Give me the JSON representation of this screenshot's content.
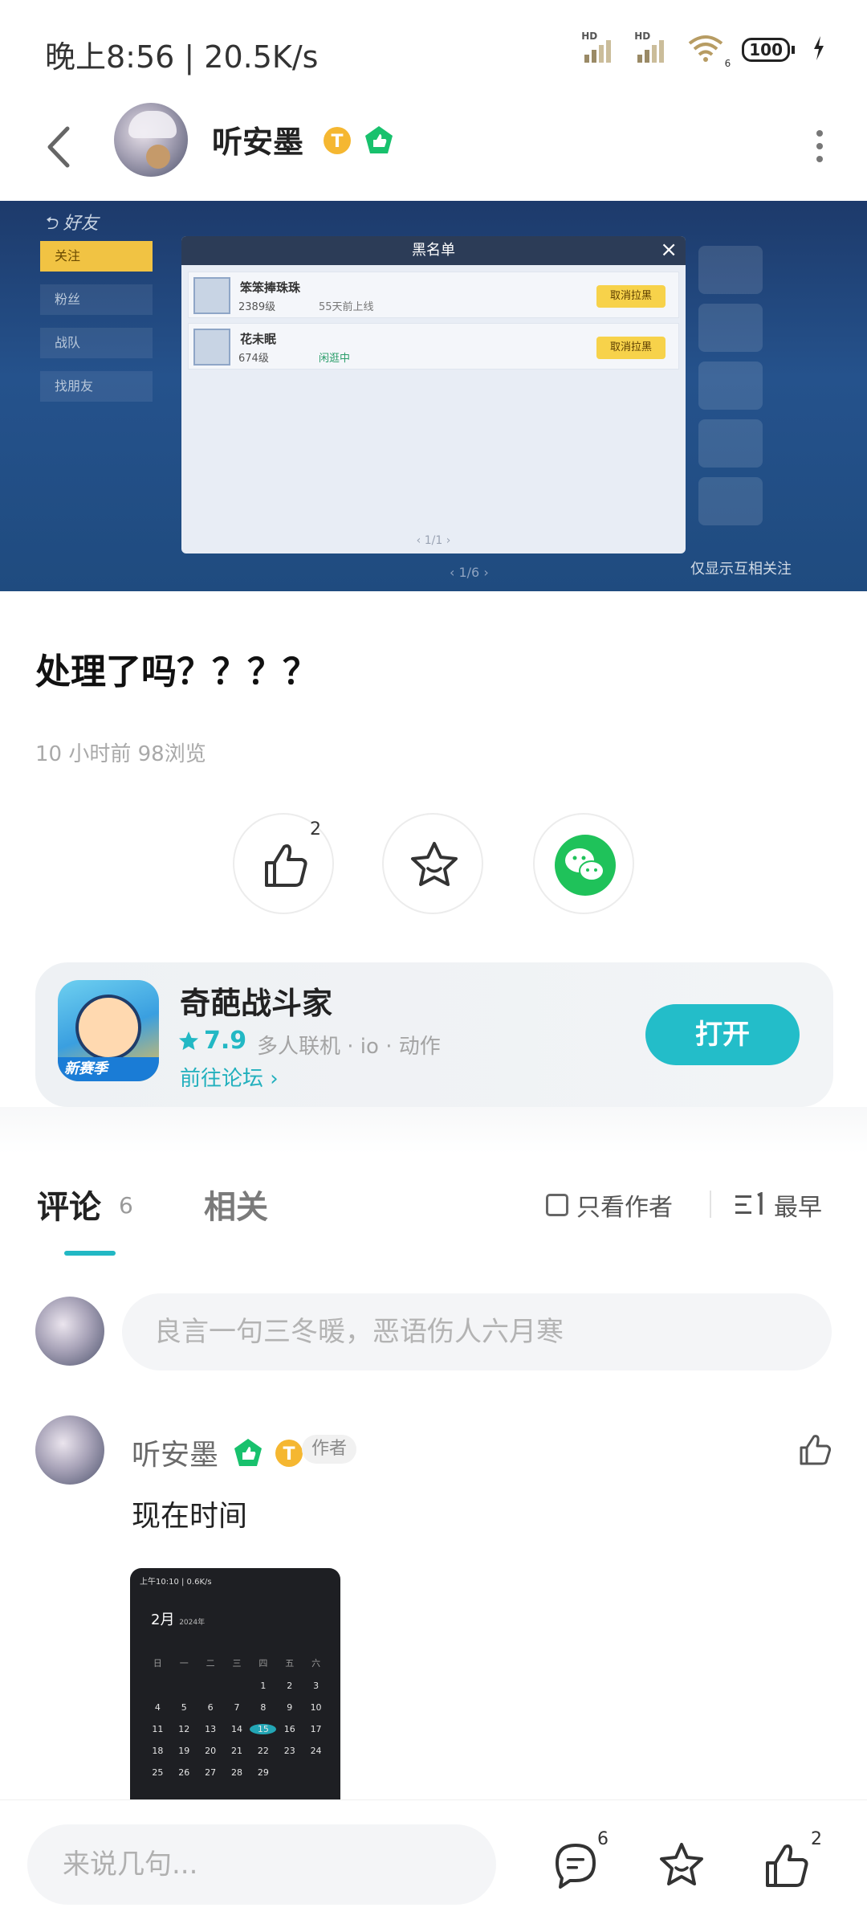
{
  "status_bar": {
    "time": "晚上8:56 | 20.5K/s",
    "battery": "100",
    "signal1": "HD",
    "signal2": "HD",
    "wifi_badge": "6"
  },
  "header": {
    "author_name": "听安墨"
  },
  "screenshot": {
    "back_label": "好友",
    "nav_items": [
      "关注",
      "粉丝",
      "战队",
      "找朋友"
    ],
    "modal_title": "黑名单",
    "rows": [
      {
        "name": "笨笨捧珠珠",
        "level": "2389级",
        "status": "55天前上线",
        "button": "取消拉黑"
      },
      {
        "name": "花未眠",
        "level": "674级",
        "status": "闲逛中",
        "button": "取消拉黑"
      }
    ],
    "pager": "1/1",
    "pager2": "1/6",
    "footnote": "仅显示互相关注"
  },
  "post": {
    "title": "处理了吗？？？？",
    "meta": "10 小时前  98浏览",
    "like_count": "2"
  },
  "game": {
    "name": "奇葩战斗家",
    "score": "7.9",
    "tags": "多人联机 · io · 动作",
    "forum_link": "前往论坛",
    "open_button": "打开",
    "icon_tag": "新赛季"
  },
  "tabs": {
    "comments_label": "评论",
    "comments_count": "6",
    "related_label": "相关",
    "only_author": "只看作者",
    "sort": "最早"
  },
  "comment_input": {
    "placeholder": "良言一句三冬暖，恶语伤人六月寒"
  },
  "comment": {
    "name": "听安墨",
    "author_tag": "作者",
    "text": "现在时间",
    "image": {
      "top": "上午10:10 | 0.6K/s",
      "month": "2月",
      "year_line": "2024年",
      "weekdays": [
        "日",
        "一",
        "二",
        "三",
        "四",
        "五",
        "六"
      ],
      "days": [
        "",
        "",
        "",
        "",
        "1",
        "2",
        "3",
        "4",
        "5",
        "6",
        "7",
        "8",
        "9",
        "10",
        "11",
        "12",
        "13",
        "14",
        "15",
        "16",
        "17",
        "18",
        "19",
        "20",
        "21",
        "22",
        "23",
        "24",
        "25",
        "26",
        "27",
        "28",
        "29",
        "",
        ""
      ],
      "today": "15"
    }
  },
  "bottom_bar": {
    "placeholder": "来说几句...",
    "comment_count": "6",
    "like_count": "2"
  },
  "colors": {
    "accent": "#23bdc9",
    "badge_gold": "#f5b731",
    "badge_green": "#18c16d",
    "wechat": "#1fc25a"
  }
}
